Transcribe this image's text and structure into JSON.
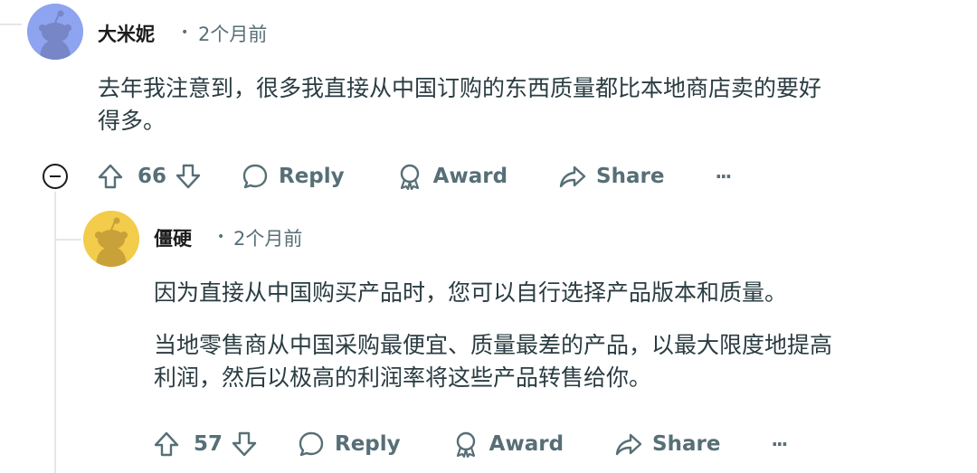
{
  "comment1": {
    "author": "大米妮",
    "separator": "•",
    "time": "2个月前",
    "body_lines": [
      "去年我注意到，很多我直接从中国订购的东西质量都比本地商店卖的要好",
      "得多。"
    ],
    "votes": "66",
    "reply": "Reply",
    "award": "Award",
    "share": "Share",
    "more": "···",
    "avatar_color": "#8fa4f0"
  },
  "comment2": {
    "author": "僵硬",
    "separator": "•",
    "time": "2个月前",
    "para1": "因为直接从中国购买产品时，您可以自行选择产品版本和质量。",
    "para2_lines": [
      "当地零售商从中国采购最便宜、质量最差的产品，以最大限度地提高",
      "利润，然后以极高的利润率将这些产品转售给你。"
    ],
    "votes": "57",
    "reply": "Reply",
    "award": "Award",
    "share": "Share",
    "more": "···",
    "avatar_color": "#f2cc4a"
  }
}
